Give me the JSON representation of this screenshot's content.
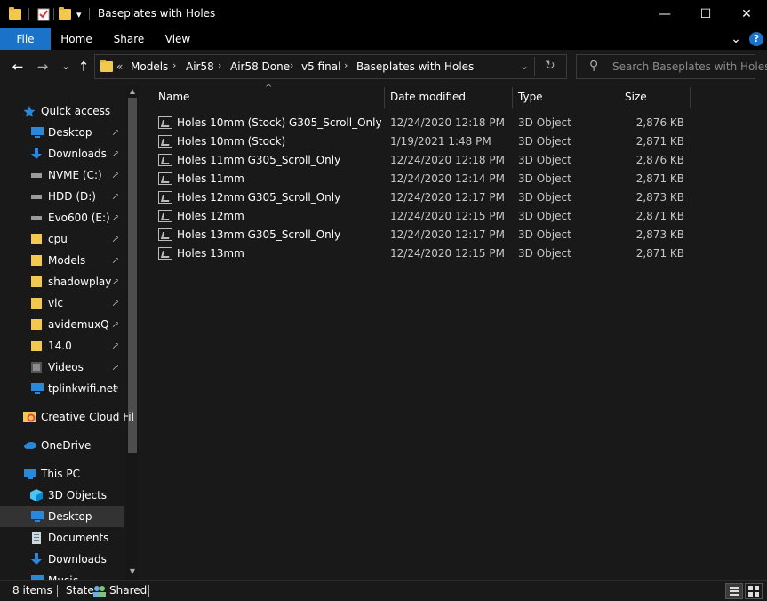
{
  "window": {
    "title": "Baseplates with Holes",
    "minimize_glyph": "—",
    "maximize_glyph": "☐",
    "close_glyph": "✕"
  },
  "quick_access_toolbar": {
    "icons": [
      "folder-icon",
      "properties-icon",
      "new-folder-icon",
      "customize-dropdown-icon"
    ],
    "dropdown_glyph": "▾"
  },
  "ribbon": {
    "tabs": [
      "File",
      "Home",
      "Share",
      "View"
    ],
    "expand_glyph": "⌄",
    "help_glyph": "?"
  },
  "navigation": {
    "back_glyph": "←",
    "forward_glyph": "→",
    "recent_glyph": "⌄",
    "up_glyph": "↑",
    "overflow_glyph": "«",
    "separator_glyph": "›",
    "breadcrumbs": [
      "Models",
      "Air58",
      "Air58 Done",
      "v5 final",
      "Baseplates with Holes"
    ],
    "dropdown_glyph": "⌄",
    "refresh_glyph": "↻"
  },
  "search": {
    "placeholder": "Search Baseplates with Holes",
    "icon_glyph": "⚲"
  },
  "sidebar": {
    "items": [
      {
        "label": "Quick access",
        "icon": "star-icon",
        "pinned": false
      },
      {
        "label": "Desktop",
        "icon": "desktop-icon",
        "pinned": true
      },
      {
        "label": "Downloads",
        "icon": "download-icon",
        "pinned": true
      },
      {
        "label": "NVME (C:)",
        "icon": "drive-icon",
        "pinned": true
      },
      {
        "label": "HDD (D:)",
        "icon": "drive-icon",
        "pinned": true
      },
      {
        "label": "Evo600 (E:)",
        "icon": "drive-icon",
        "pinned": true
      },
      {
        "label": "cpu",
        "icon": "folder-icon",
        "pinned": true
      },
      {
        "label": "Models",
        "icon": "folder-icon",
        "pinned": true
      },
      {
        "label": "shadowplay",
        "icon": "folder-icon",
        "pinned": true
      },
      {
        "label": "vlc",
        "icon": "folder-icon",
        "pinned": true
      },
      {
        "label": "avidemuxQ",
        "icon": "folder-icon",
        "pinned": true
      },
      {
        "label": "14.0",
        "icon": "folder-icon",
        "pinned": true
      },
      {
        "label": "Videos",
        "icon": "videos-icon",
        "pinned": true
      },
      {
        "label": "tplinkwifi.net",
        "icon": "network-icon",
        "pinned": true
      },
      {
        "label": "Creative Cloud Fil",
        "icon": "creative-cloud-icon",
        "pinned": false
      },
      {
        "label": "OneDrive",
        "icon": "onedrive-icon",
        "pinned": false
      },
      {
        "label": "This PC",
        "icon": "computer-icon",
        "pinned": false
      },
      {
        "label": "3D Objects",
        "icon": "3d-objects-icon",
        "pinned": false
      },
      {
        "label": "Desktop",
        "icon": "desktop-icon",
        "pinned": false
      },
      {
        "label": "Documents",
        "icon": "documents-icon",
        "pinned": false
      },
      {
        "label": "Downloads",
        "icon": "download-icon",
        "pinned": false
      },
      {
        "label": "Music",
        "icon": "music-icon",
        "pinned": false
      }
    ],
    "pin_glyph": "📌",
    "selected_index": 18
  },
  "file_list": {
    "sort_glyph": "^",
    "columns": [
      "Name",
      "Date modified",
      "Type",
      "Size"
    ],
    "rows": [
      {
        "name": "Holes 10mm (Stock) G305_Scroll_Only",
        "date": "12/24/2020 12:18 PM",
        "type": "3D Object",
        "size": "2,876 KB"
      },
      {
        "name": "Holes 10mm (Stock)",
        "date": "1/19/2021 1:48 PM",
        "type": "3D Object",
        "size": "2,871 KB"
      },
      {
        "name": "Holes 11mm G305_Scroll_Only",
        "date": "12/24/2020 12:18 PM",
        "type": "3D Object",
        "size": "2,876 KB"
      },
      {
        "name": "Holes 11mm",
        "date": "12/24/2020 12:14 PM",
        "type": "3D Object",
        "size": "2,871 KB"
      },
      {
        "name": "Holes 12mm G305_Scroll_Only",
        "date": "12/24/2020 12:17 PM",
        "type": "3D Object",
        "size": "2,873 KB"
      },
      {
        "name": "Holes 12mm",
        "date": "12/24/2020 12:15 PM",
        "type": "3D Object",
        "size": "2,871 KB"
      },
      {
        "name": "Holes 13mm G305_Scroll_Only",
        "date": "12/24/2020 12:17 PM",
        "type": "3D Object",
        "size": "2,873 KB"
      },
      {
        "name": "Holes 13mm",
        "date": "12/24/2020 12:15 PM",
        "type": "3D Object",
        "size": "2,871 KB"
      }
    ]
  },
  "status_bar": {
    "item_count": "8 items",
    "state_label": "State:",
    "state_value": "Shared"
  },
  "colors": {
    "accent": "#1a73c9",
    "background": "#191919",
    "titlebar": "#000000",
    "folder": "#f2c94c"
  }
}
